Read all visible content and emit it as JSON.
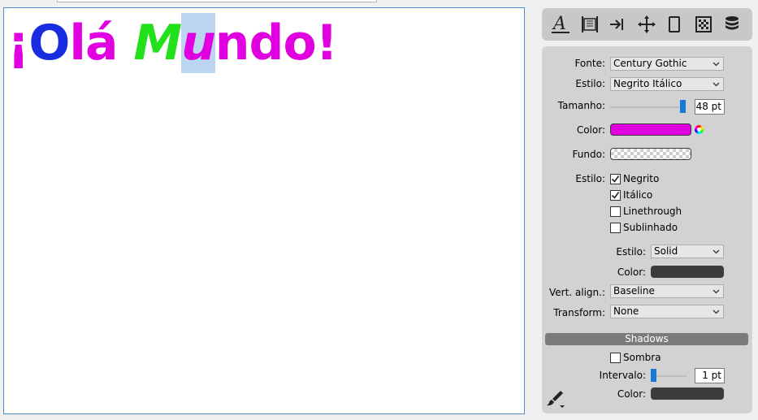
{
  "canvas": {
    "headline": [
      {
        "text": "¡",
        "color": "#e000e0",
        "italic": false,
        "selected": false
      },
      {
        "text": "O",
        "color": "#1a2ce0",
        "italic": false,
        "selected": false
      },
      {
        "text": "lá ",
        "color": "#e000e0",
        "italic": false,
        "selected": false
      },
      {
        "text": "M",
        "color": "#22e01a",
        "italic": true,
        "selected": false
      },
      {
        "text": "u",
        "color": "#e000e0",
        "italic": true,
        "selected": true
      },
      {
        "text": "ndo!",
        "color": "#e000e0",
        "italic": false,
        "selected": false
      }
    ]
  },
  "toolbar": {
    "icons": [
      "text-style-icon",
      "paragraph-icon",
      "indent-icon",
      "move-icon",
      "page-icon",
      "pattern-icon",
      "database-icon"
    ]
  },
  "font": {
    "fonte_label": "Fonte:",
    "fonte_value": "Century Gothic",
    "estilo_label": "Estilo:",
    "estilo_value": "Negrito Itálico",
    "tamanho_label": "Tamanho:",
    "tamanho_value": "48 pt",
    "tamanho_level": 1.0,
    "color_label": "Color:",
    "color_value": "#e000e0",
    "fundo_label": "Fundo:",
    "estilo2_label": "Estilo:",
    "checks": [
      {
        "label": "Negrito",
        "checked": true
      },
      {
        "label": "Itálico",
        "checked": true
      },
      {
        "label": "Linethrough",
        "checked": false
      },
      {
        "label": "Sublinhado",
        "checked": false
      }
    ],
    "line_style_label": "Estilo:",
    "line_style_value": "Solid",
    "line_color_label": "Color:",
    "line_color_value": "#3c3c3c",
    "valign_label": "Vert. align.:",
    "valign_value": "Baseline",
    "transform_label": "Transform:",
    "transform_value": "None"
  },
  "shadows": {
    "title": "Shadows",
    "sombra_label": "Sombra",
    "sombra_checked": false,
    "intervalo_label": "Intervalo:",
    "intervalo_value": "1 pt",
    "intervalo_level": 0.0,
    "color_label": "Color:",
    "color_value": "#3c3c3c"
  },
  "colors": {
    "accent": "#1a78d6",
    "panel_bg": "#d2d2d2"
  }
}
